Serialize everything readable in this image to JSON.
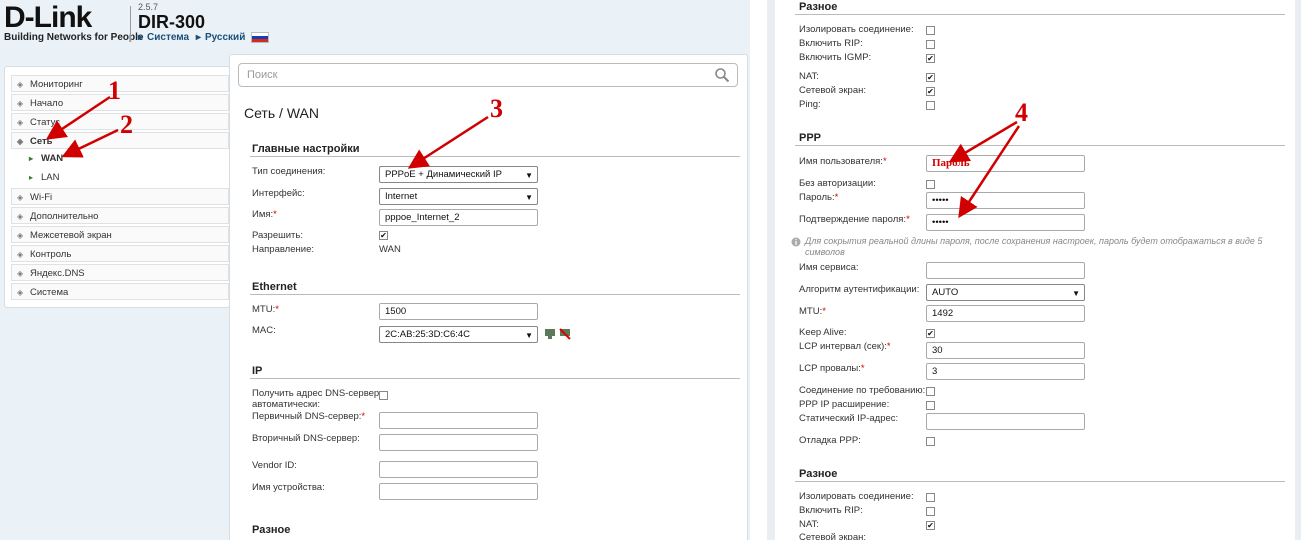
{
  "header": {
    "brand": "D-Link",
    "tagline": "Building Networks for People",
    "version": "2.5.7",
    "model": "DIR-300",
    "crumb_system": "Система",
    "crumb_lang": "Русский"
  },
  "sidebar": {
    "items": [
      {
        "label": "Мониторинг"
      },
      {
        "label": "Начало"
      },
      {
        "label": "Статус"
      },
      {
        "label": "Сеть"
      },
      {
        "label": "WAN"
      },
      {
        "label": "LAN"
      },
      {
        "label": "Wi-Fi"
      },
      {
        "label": "Дополнительно"
      },
      {
        "label": "Межсетевой экран"
      },
      {
        "label": "Контроль"
      },
      {
        "label": "Яндекс.DNS"
      },
      {
        "label": "Система"
      }
    ]
  },
  "main": {
    "search_placeholder": "Поиск",
    "title_prefix": "Сеть /",
    "title_page": "WAN",
    "general": {
      "title": "Главные настройки",
      "conn_type_label": "Тип соединения:",
      "conn_type_value": "PPPoE + Динамический IP",
      "iface_label": "Интерфейс:",
      "iface_value": "Internet",
      "name_label": "Имя:",
      "name_value": "pppoe_Internet_2",
      "enable_label": "Разрешить:",
      "direction_label": "Направление:",
      "direction_value": "WAN"
    },
    "ethernet": {
      "title": "Ethernet",
      "mtu_label": "MTU:",
      "mtu_value": "1500",
      "mac_label": "MAC:",
      "mac_value": "2C:AB:25:3D:C6:4C"
    },
    "ip": {
      "title": "IP",
      "dns_auto_label_1": "Получить адрес DNS-сервера",
      "dns_auto_label_2": "автоматически:",
      "dns1_label": "Первичный DNS-сервер:",
      "dns2_label": "Вторичный DNS-сервер:",
      "vendor_label": "Vendor ID:",
      "device_label": "Имя устройства:"
    },
    "misc_title": "Разное"
  },
  "right": {
    "misc_top": {
      "title": "Разное",
      "isolate": "Изолировать соединение:",
      "rip": "Включить RIP:",
      "igmp": "Включить IGMP:",
      "nat": "NAT:",
      "firewall": "Сетевой экран:",
      "ping": "Ping:"
    },
    "ppp": {
      "title": "PPP",
      "user_label": "Имя пользователя:",
      "user_value": "Пароль",
      "noauth_label": "Без авторизации:",
      "pass_label": "Пароль:",
      "pass_value": "•••••",
      "confirm_label": "Подтверждение пароля:",
      "confirm_value": "•••••",
      "hint": "Для сокрытия реальной длины пароля, после сохранения настроек, пароль будет отображаться в виде 5 символов",
      "service_label": "Имя сервиса:",
      "auth_label": "Алгоритм аутентификации:",
      "auth_value": "AUTO",
      "mtu_label": "MTU:",
      "mtu_value": "1492",
      "keepalive_label": "Keep Alive:",
      "lcp_interval_label": "LCP интервал (сек):",
      "lcp_interval_value": "30",
      "lcp_fail_label": "LCP провалы:",
      "lcp_fail_value": "3",
      "ondemand_label": "Соединение по требованию:",
      "ppp_ip_ext_label": "PPP IP расширение:",
      "static_ip_label": "Статический IP-адрес:",
      "debug_label": "Отладка PPP:"
    },
    "misc_bottom": {
      "title": "Разное",
      "isolate": "Изолировать соединение:",
      "rip": "Включить RIP:",
      "nat": "NAT:",
      "firewall": "Сетевой экран:"
    }
  },
  "annotations": {
    "n1": "1",
    "n2": "2",
    "n3": "3",
    "n4": "4"
  },
  "colors": {
    "annotation": "#d10000",
    "link": "#1a4e78",
    "panel_bg": "#eaf2f8"
  }
}
